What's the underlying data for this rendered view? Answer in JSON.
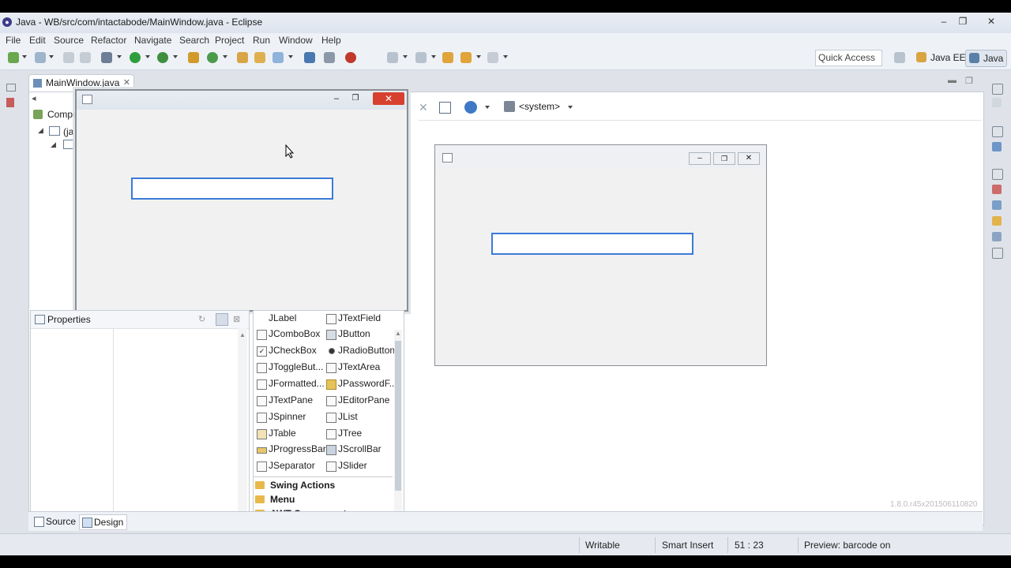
{
  "window": {
    "title": "Java - WB/src/com/intactabode/MainWindow.java - Eclipse"
  },
  "menu": [
    "File",
    "Edit",
    "Source",
    "Refactor",
    "Navigate",
    "Search",
    "Project",
    "Run",
    "Window",
    "Help"
  ],
  "toolbar": {
    "quick_access_label": "Quick Access",
    "perspectives": [
      "Java EE",
      "Java"
    ]
  },
  "editor": {
    "tab_label": "MainWindow.java",
    "components_label": "Compe",
    "tree_item": "(ja",
    "lookandfeel": "<system>"
  },
  "properties": {
    "title": "Properties"
  },
  "palette": {
    "items": [
      [
        "JLabel",
        "JTextField"
      ],
      [
        "JComboBox",
        "JButton"
      ],
      [
        "JCheckBox",
        "JRadioButton"
      ],
      [
        "JToggleBut...",
        "JTextArea"
      ],
      [
        "JFormatted...",
        "JPasswordF..."
      ],
      [
        "JTextPane",
        "JEditorPane"
      ],
      [
        "JSpinner",
        "JList"
      ],
      [
        "JTable",
        "JTree"
      ],
      [
        "JProgressBar",
        "JScrollBar"
      ],
      [
        "JSeparator",
        "JSlider"
      ]
    ],
    "categories": [
      "Swing Actions",
      "Menu",
      "AWT Components"
    ]
  },
  "bottom_tabs": [
    "Source",
    "Design"
  ],
  "status": {
    "writable": "Writable",
    "insert_mode": "Smart Insert",
    "position": "51 : 23",
    "preview": "Preview: barcode on"
  },
  "version_text": "1.8.0.r45x201506110820",
  "colors": {
    "accent": "#3b7ad9",
    "close_red": "#d7402e"
  }
}
